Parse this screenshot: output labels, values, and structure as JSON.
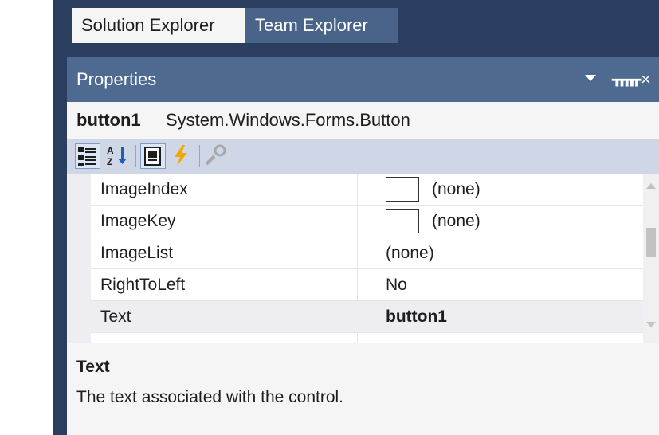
{
  "tabs": [
    {
      "label": "Solution Explorer",
      "active": true
    },
    {
      "label": "Team Explorer",
      "active": false
    }
  ],
  "panel": {
    "title": "Properties",
    "header_icons": [
      "dropdown-arrow-icon",
      "pin-icon",
      "close-icon"
    ],
    "pin_glyph": "ᚅ",
    "close_glyph": "×"
  },
  "object": {
    "name": "button1",
    "type": "System.Windows.Forms.Button"
  },
  "toolbar": {
    "buttons": [
      "categorized-icon",
      "alphabetical-icon",
      "properties-icon",
      "events-icon",
      "property-pages-icon"
    ]
  },
  "properties": [
    {
      "name": "ImageIndex",
      "value": "(none)",
      "swatch": true
    },
    {
      "name": "ImageKey",
      "value": "(none)",
      "swatch": true
    },
    {
      "name": "ImageList",
      "value": "(none)"
    },
    {
      "name": "RightToLeft",
      "value": "No"
    },
    {
      "name": "Text",
      "value": "button1",
      "selected": true,
      "bold": true
    }
  ],
  "description": {
    "title": "Text",
    "text": "The text associated with the control."
  },
  "colors": {
    "frame": "#2c3e5f",
    "header": "#4e6a91",
    "toolbar": "#cfd6e5",
    "events_icon": "#f2a800"
  }
}
